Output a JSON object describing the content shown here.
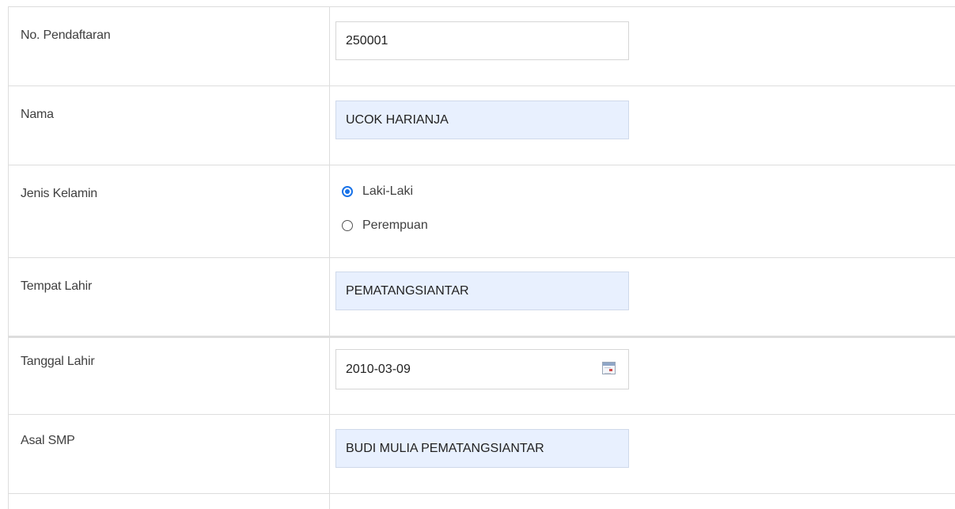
{
  "form": {
    "no_pendaftaran": {
      "label": "No. Pendaftaran",
      "value": "250001"
    },
    "nama": {
      "label": "Nama",
      "value": "UCOK HARIANJA"
    },
    "jenis_kelamin": {
      "label": "Jenis Kelamin",
      "options": [
        {
          "label": "Laki-Laki",
          "checked": true
        },
        {
          "label": "Perempuan",
          "checked": false
        }
      ]
    },
    "tempat_lahir": {
      "label": "Tempat Lahir",
      "value": "PEMATANGSIANTAR"
    },
    "tanggal_lahir": {
      "label": "Tanggal Lahir",
      "value": "2010-03-09",
      "icon": "calendar-icon"
    },
    "asal_smp": {
      "label": "Asal SMP",
      "value": "BUDI MULIA PEMATANGSIANTAR"
    }
  },
  "colors": {
    "autofill_background": "#e8f0fe",
    "radio_accent": "#1a73e8",
    "border": "#dddddd"
  }
}
